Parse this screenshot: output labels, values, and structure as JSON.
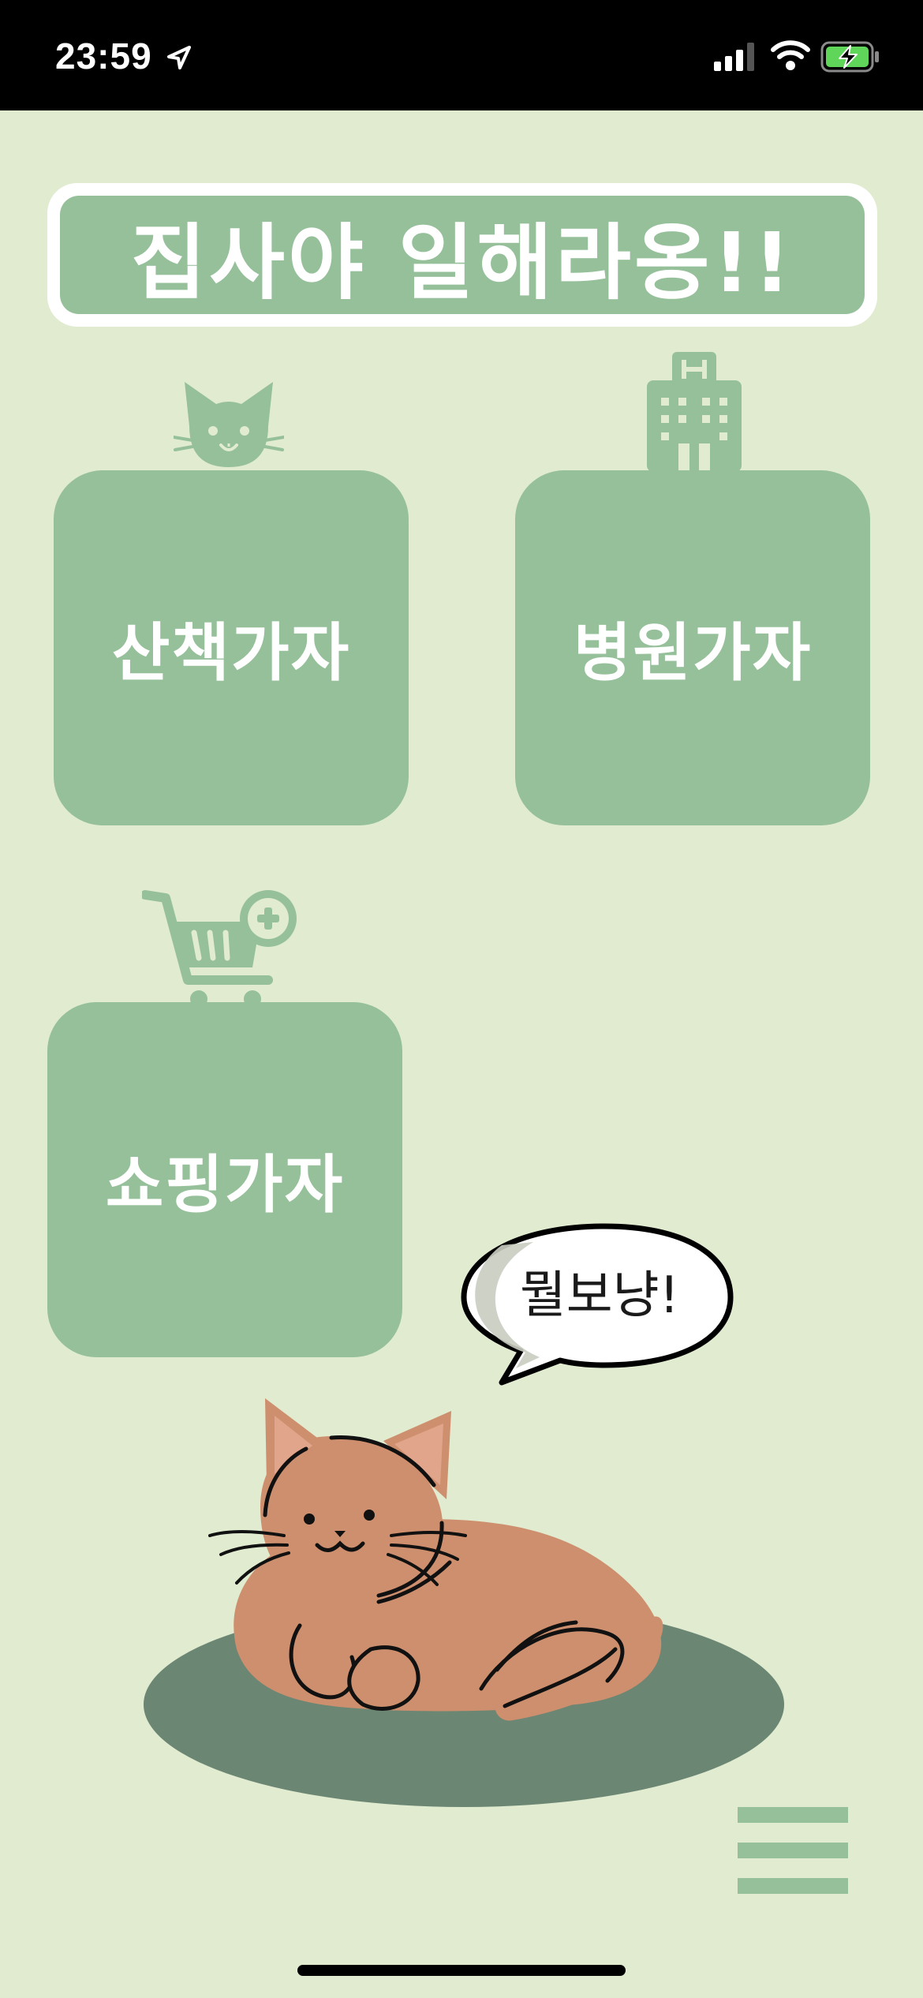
{
  "status_bar": {
    "time": "23:59",
    "icons": [
      "location-arrow-icon",
      "signal-icon",
      "wifi-icon",
      "battery-charging-icon"
    ]
  },
  "header": {
    "title": "집사야 일해라옹!!"
  },
  "cards": {
    "walk": {
      "label": "산책가자",
      "icon": "cat-face-icon"
    },
    "hospital": {
      "label": "병원가자",
      "icon": "hospital-building-icon"
    },
    "shopping": {
      "label": "쇼핑가자",
      "icon": "shopping-cart-plus-icon"
    }
  },
  "speech_bubble": {
    "text": "뭘보냥!"
  },
  "menu": {
    "icon": "hamburger-menu-icon"
  },
  "colors": {
    "background": "#e1ebd0",
    "accent": "#95c09a",
    "cat_body": "#cd8f6d",
    "cushion": "#6b8673"
  }
}
